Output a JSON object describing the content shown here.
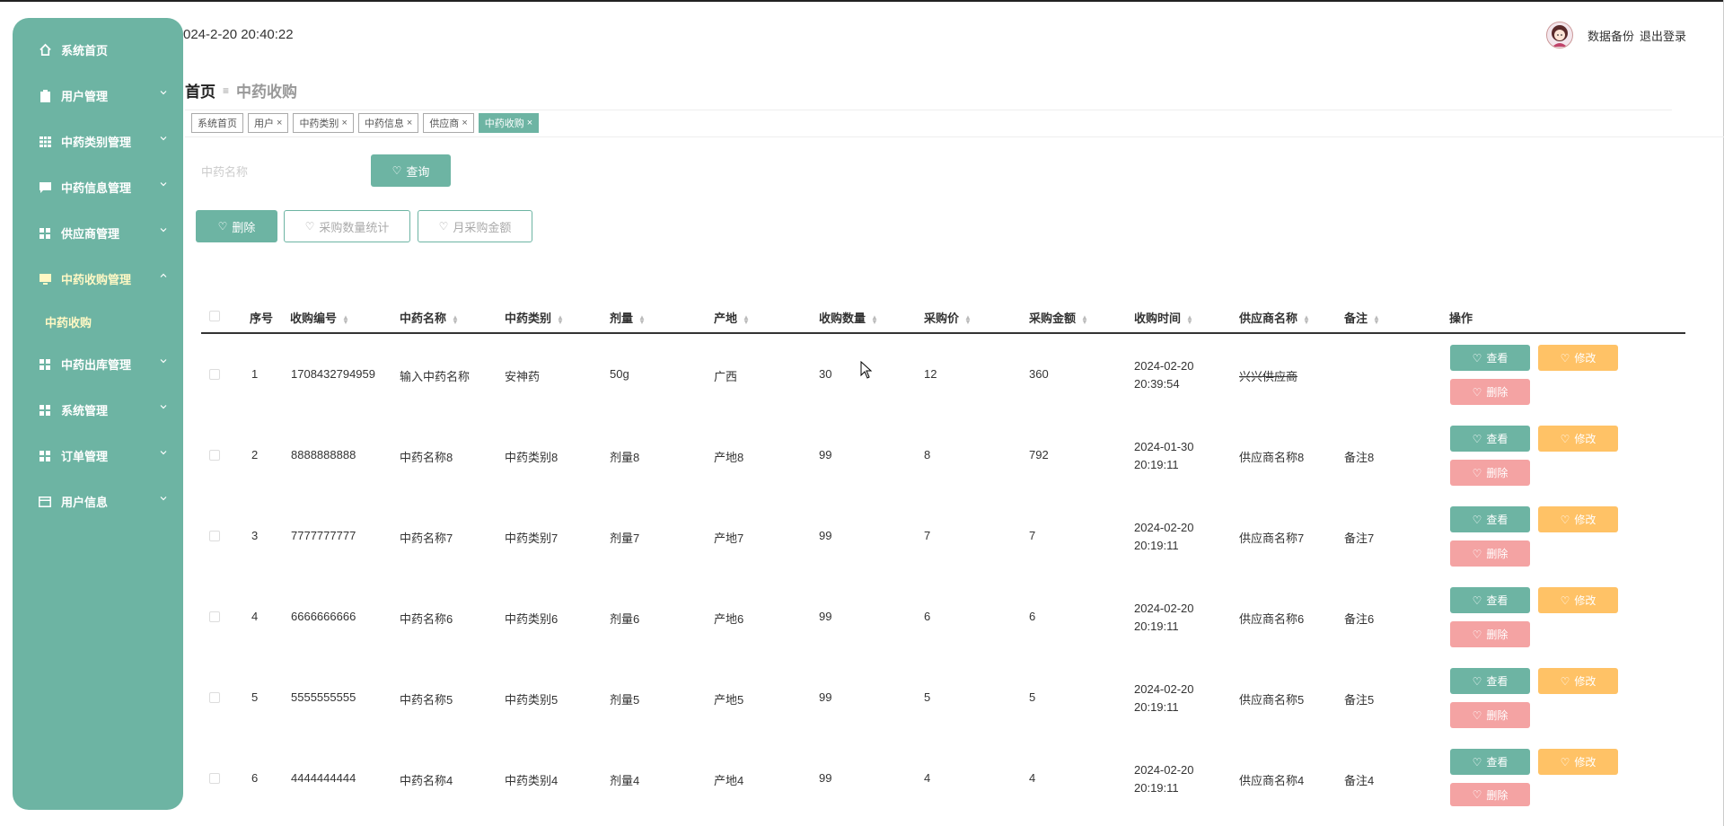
{
  "header": {
    "datetime": "024-2-20 20:40:22",
    "backup_label": "数据备份",
    "logout_label": "退出登录"
  },
  "sidebar": {
    "items": [
      {
        "label": "系统首页",
        "icon": "home-icon"
      },
      {
        "label": "用户管理",
        "icon": "clipboard-icon"
      },
      {
        "label": "中药类别管理",
        "icon": "grid-icon"
      },
      {
        "label": "中药信息管理",
        "icon": "chat-icon"
      },
      {
        "label": "供应商管理",
        "icon": "apps-icon"
      },
      {
        "label": "中药收购管理",
        "icon": "monitor-icon"
      },
      {
        "label": "中药出库管理",
        "icon": "apps-icon"
      },
      {
        "label": "系统管理",
        "icon": "apps-icon"
      },
      {
        "label": "订单管理",
        "icon": "apps-icon"
      },
      {
        "label": "用户信息",
        "icon": "card-icon"
      }
    ],
    "submenu": {
      "label": "中药收购"
    }
  },
  "breadcrumb": {
    "home": "首页",
    "current": "中药收购"
  },
  "tags": [
    {
      "label": "系统首页"
    },
    {
      "label": "用户"
    },
    {
      "label": "中药类别"
    },
    {
      "label": "中药信息"
    },
    {
      "label": "供应商"
    },
    {
      "label": "中药收购"
    }
  ],
  "search": {
    "placeholder": "中药名称",
    "button": "查询"
  },
  "actions": {
    "delete": "删除",
    "stat_qty": "采购数量统计",
    "stat_month": "月采购金额"
  },
  "table": {
    "headers": [
      "序号",
      "收购编号",
      "中药名称",
      "中药类别",
      "剂量",
      "产地",
      "收购数量",
      "采购价",
      "采购金额",
      "收购时间",
      "供应商名称",
      "备注",
      "操作"
    ],
    "rows": [
      {
        "no": "1",
        "code": "1708432794959",
        "name": "输入中药名称",
        "type": "安神药",
        "dose": "50g",
        "origin": "广西",
        "qty": "30",
        "price": "12",
        "amount": "360",
        "time": "2024-02-20 20:39:54",
        "supplier": "兴兴供应商",
        "note": ""
      },
      {
        "no": "2",
        "code": "8888888888",
        "name": "中药名称8",
        "type": "中药类别8",
        "dose": "剂量8",
        "origin": "产地8",
        "qty": "99",
        "price": "8",
        "amount": "792",
        "time": "2024-01-30 20:19:11",
        "supplier": "供应商名称8",
        "note": "备注8"
      },
      {
        "no": "3",
        "code": "7777777777",
        "name": "中药名称7",
        "type": "中药类别7",
        "dose": "剂量7",
        "origin": "产地7",
        "qty": "99",
        "price": "7",
        "amount": "7",
        "time": "2024-02-20 20:19:11",
        "supplier": "供应商名称7",
        "note": "备注7"
      },
      {
        "no": "4",
        "code": "6666666666",
        "name": "中药名称6",
        "type": "中药类别6",
        "dose": "剂量6",
        "origin": "产地6",
        "qty": "99",
        "price": "6",
        "amount": "6",
        "time": "2024-02-20 20:19:11",
        "supplier": "供应商名称6",
        "note": "备注6"
      },
      {
        "no": "5",
        "code": "5555555555",
        "name": "中药名称5",
        "type": "中药类别5",
        "dose": "剂量5",
        "origin": "产地5",
        "qty": "99",
        "price": "5",
        "amount": "5",
        "time": "2024-02-20 20:19:11",
        "supplier": "供应商名称5",
        "note": "备注5"
      },
      {
        "no": "6",
        "code": "4444444444",
        "name": "中药名称4",
        "type": "中药类别4",
        "dose": "剂量4",
        "origin": "产地4",
        "qty": "99",
        "price": "4",
        "amount": "4",
        "time": "2024-02-20 20:19:11",
        "supplier": "供应商名称4",
        "note": "备注4"
      }
    ],
    "op_view": "查看",
    "op_edit": "修改",
    "op_delete": "删除"
  },
  "colors": {
    "primary": "#6db4a3",
    "edit": "#ffc266",
    "danger": "#f4a3a3",
    "active_text": "#fff8c4"
  }
}
